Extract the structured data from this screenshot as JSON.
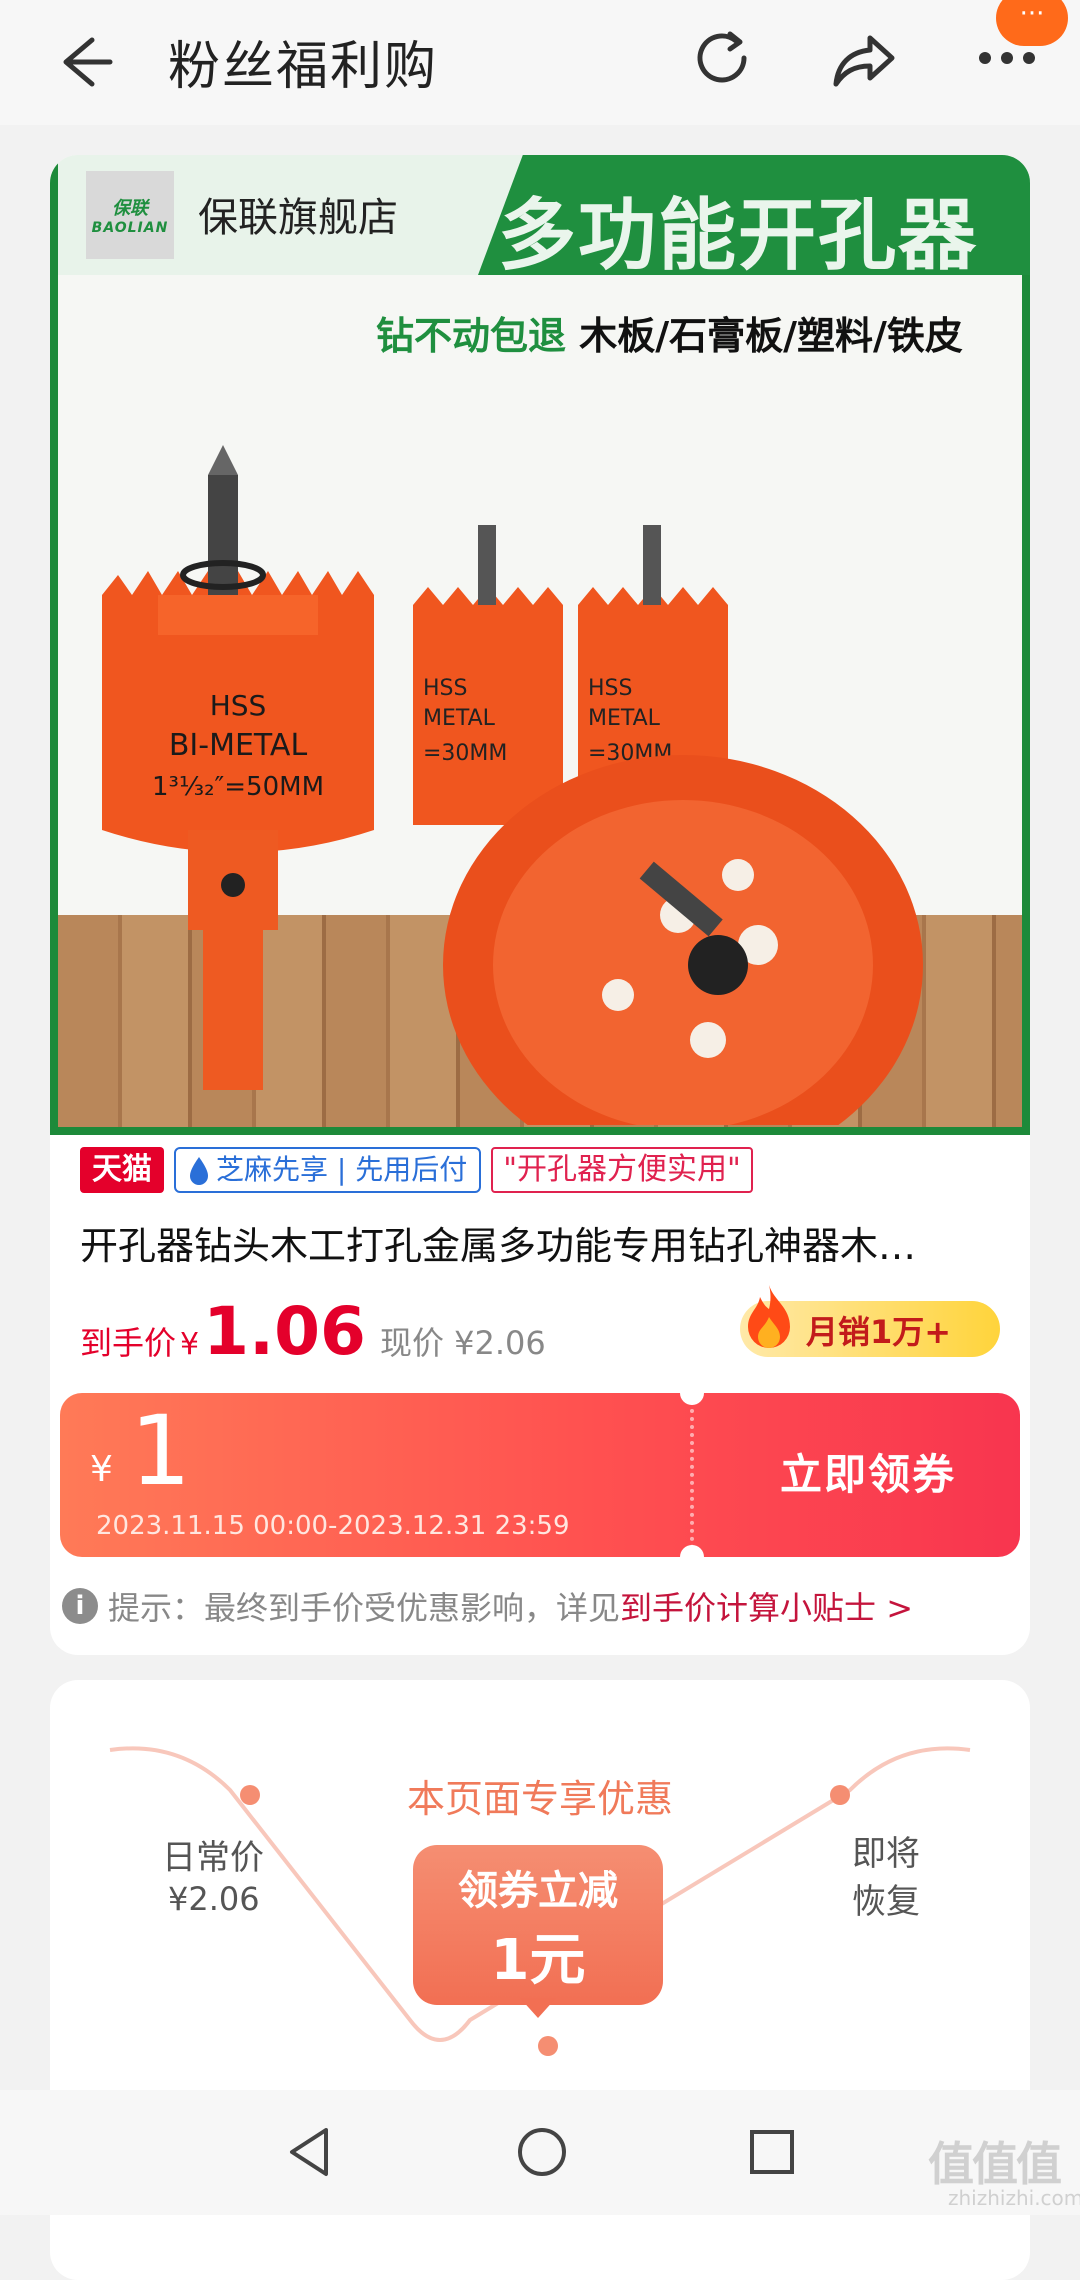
{
  "topbar": {
    "title": "粉丝福利购",
    "badge_text": "···"
  },
  "store": {
    "logo_cn": "保联",
    "logo_en": "BAOLIAN",
    "name": "保联旗舰店"
  },
  "banner": {
    "headline": "多功能开孔器",
    "tag_green": "钻不动包退",
    "tag_black": " 木板/石膏板/塑料/铁皮",
    "saw_label_1": "HSS",
    "saw_label_2": "BI-METAL",
    "saw_label_3": "1³¹⁄₃₂″=50MM",
    "saw_small_1": "HSS",
    "saw_small_2": "METAL",
    "saw_small_3": "=30MM"
  },
  "badges": {
    "tmall": "天猫",
    "zhima": "芝麻先享 | 先用后付",
    "quote": "\"开孔器方便实用\""
  },
  "product": {
    "title": "开孔器钻头木工打孔金属多功能专用钻孔神器木…",
    "price_label": "到手价",
    "price_symbol": "¥",
    "price_value": "1.06",
    "price_now": "现价 ¥2.06",
    "sales": "月销1万+"
  },
  "coupon": {
    "symbol": "¥",
    "amount": "1",
    "date_range": "2023.11.15 00:00-2023.12.31 23:59",
    "button": "立即领券"
  },
  "tip": {
    "icon": "info-icon",
    "prefix": "提示：最终到手价受优惠影响，详见",
    "link": "到手价计算小贴士 >"
  },
  "promo": {
    "head": "本页面专享优惠",
    "daily_label": "日常价",
    "daily_value": "¥2.06",
    "restore": "即将恢复",
    "box_line1": "领券立减",
    "box_line2": "1元"
  },
  "watermark": {
    "main": "值值值",
    "sub": "zhizhizhi.com"
  },
  "colors": {
    "accent_red": "#e4002b",
    "tmall_red": "#e4002b",
    "brand_green": "#1f8f3f",
    "coupon_orange": "#ff5150",
    "promo_orange": "#f26f53"
  }
}
